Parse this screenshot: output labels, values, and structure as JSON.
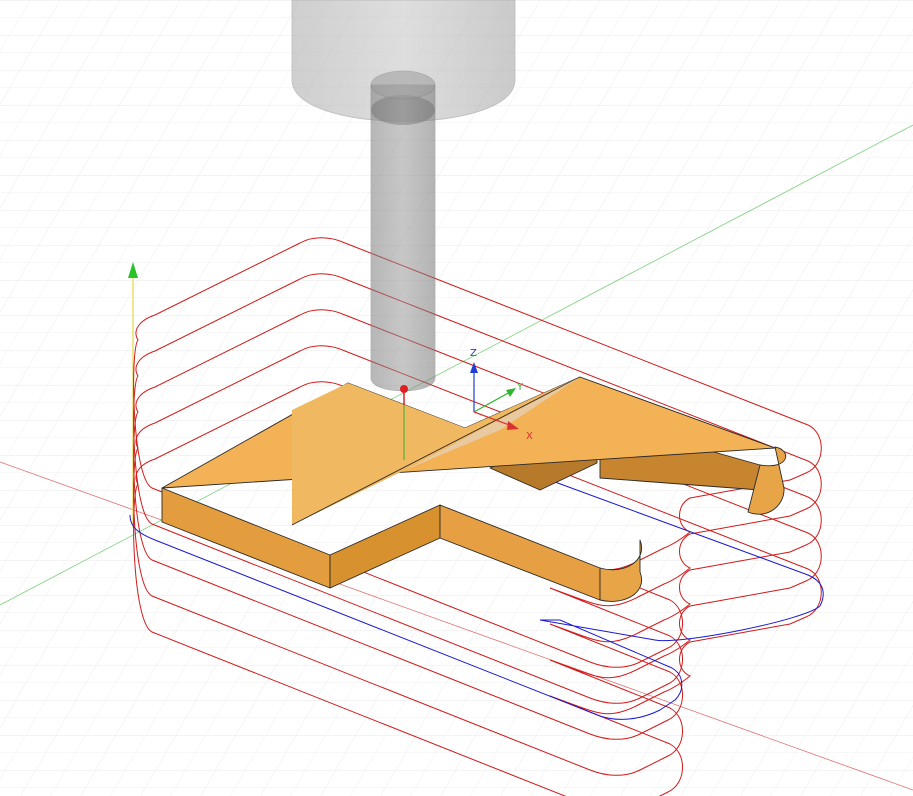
{
  "scene": {
    "triad": {
      "x_label": "X",
      "y_label": "Y",
      "z_label": "Z"
    },
    "colors": {
      "background": "#ffffff",
      "grid": "#d9d9d9",
      "part_top": "#f3b256",
      "part_side": "#e39d3e",
      "part_edge": "#2a2a2a",
      "toolpath_cutting": "#d11a1a",
      "toolpath_lead": "#1a1ad1",
      "tool": "#8c8c8c",
      "axis_x": "#d93030",
      "axis_y": "#2fb52f",
      "axis_z": "#1f3fd6"
    },
    "tool": {
      "type": "flat-end-mill"
    },
    "toolpath": {
      "passes": 5
    }
  }
}
